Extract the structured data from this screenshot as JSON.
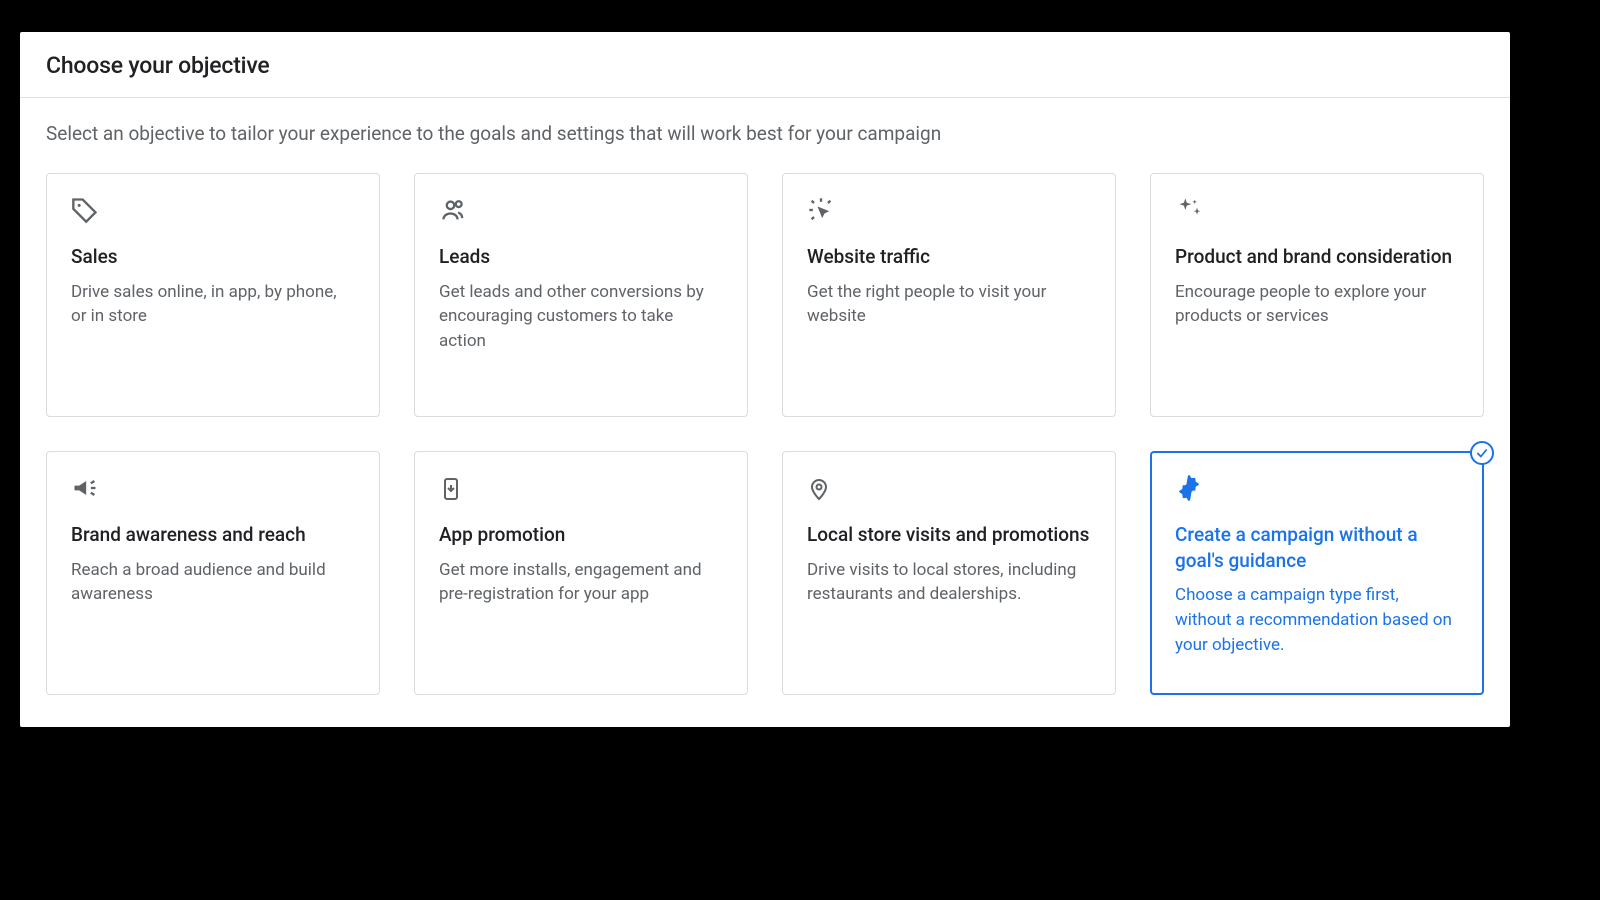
{
  "header": {
    "title": "Choose your objective"
  },
  "subtitle": "Select an objective to tailor your experience to the goals and settings that will work best for your campaign",
  "cards": [
    {
      "icon": "tag-icon",
      "title": "Sales",
      "desc": "Drive sales online, in app, by phone, or in store",
      "selected": false
    },
    {
      "icon": "people-icon",
      "title": "Leads",
      "desc": "Get leads and other conversions by encouraging customers to take action",
      "selected": false
    },
    {
      "icon": "click-icon",
      "title": "Website traffic",
      "desc": "Get the right people to visit your website",
      "selected": false
    },
    {
      "icon": "sparkle-icon",
      "title": "Product and brand consideration",
      "desc": "Encourage people to explore your products or services",
      "selected": false
    },
    {
      "icon": "megaphone-icon",
      "title": "Brand awareness and reach",
      "desc": "Reach a broad audience and build awareness",
      "selected": false
    },
    {
      "icon": "app-icon",
      "title": "App promotion",
      "desc": "Get more installs, engagement and pre-registration for your app",
      "selected": false
    },
    {
      "icon": "pin-icon",
      "title": "Local store visits and promotions",
      "desc": "Drive visits to local stores, including restaurants and dealerships.",
      "selected": false
    },
    {
      "icon": "gear-icon",
      "title": "Create a campaign without a goal's guidance",
      "desc": "Choose a campaign type first, without a recommendation based on your objective.",
      "selected": true
    }
  ],
  "colors": {
    "accent": "#1a73e8",
    "text": "#202124",
    "muted": "#5f6368",
    "border": "#dadce0"
  }
}
